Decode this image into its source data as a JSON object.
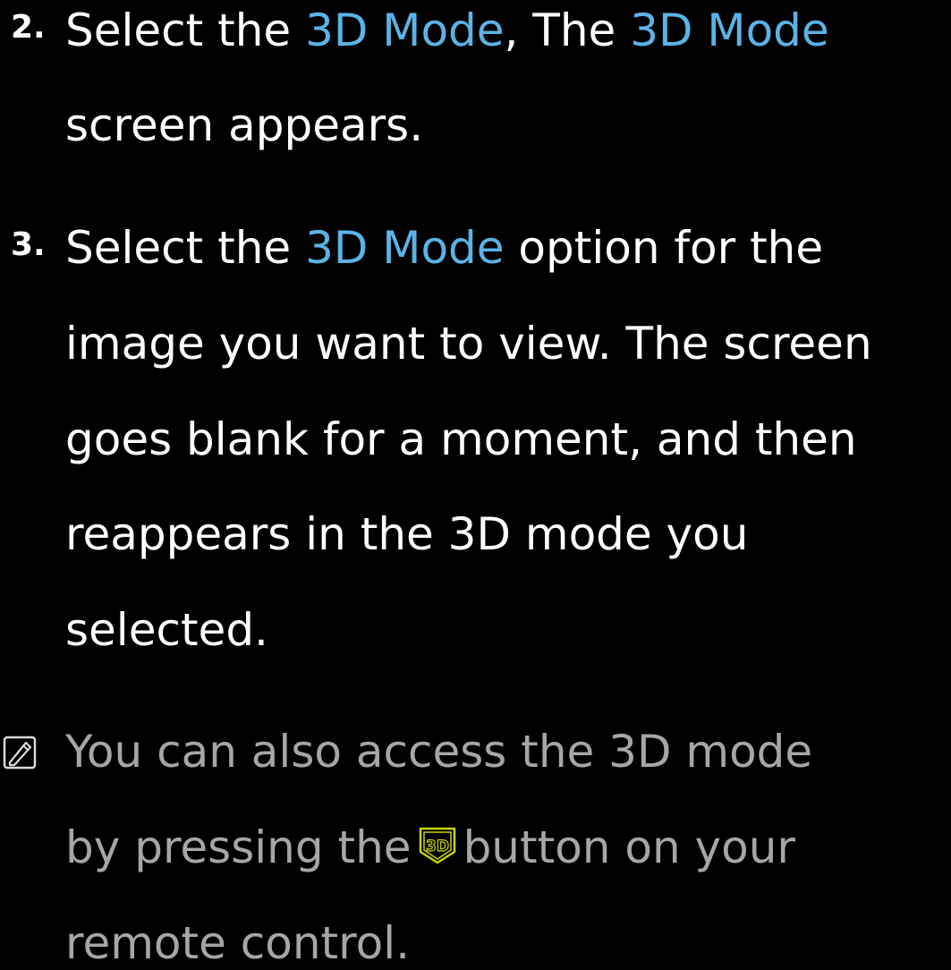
{
  "step2": {
    "number": "2.",
    "line1": {
      "t1": "Select the ",
      "hl1": "3D Mode",
      "t2": ", The ",
      "hl2": "3D Mode"
    },
    "line2": "screen appears."
  },
  "step3": {
    "number": "3.",
    "line1": {
      "t1": "Select the ",
      "hl1": "3D Mode",
      "t2": " option for the"
    },
    "line2": "image you want to view. The screen",
    "line3": "goes blank for a moment, and then",
    "line4": "reappears in the 3D mode you",
    "line5": "selected."
  },
  "note": {
    "icon": "note-icon",
    "line1": "You can also access the 3D mode",
    "line2": {
      "t1": "by pressing the",
      "button_icon": "3d-button-icon",
      "t2": "button on your"
    },
    "line3": "remote control."
  },
  "colors": {
    "background": "#000000",
    "text": "#ffffff",
    "highlight": "#5bb3e6",
    "note_text": "#a6a6a6",
    "button_icon": "#c8d400"
  }
}
